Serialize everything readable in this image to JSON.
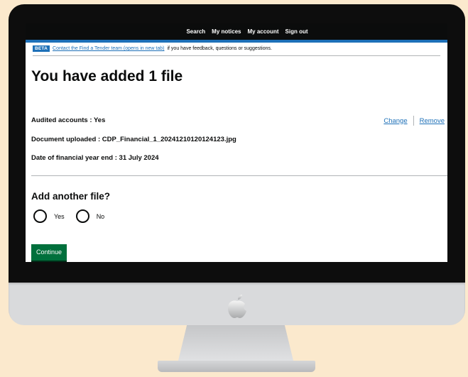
{
  "nav": {
    "links": [
      "Search",
      "My notices",
      "My account",
      "Sign out"
    ]
  },
  "banner": {
    "tag": "BETA",
    "link_text": "Contact the Find a Tender team (opens in new tab)",
    "rest_text": "if you have feedback, questions or suggestions."
  },
  "page": {
    "title": "You have added 1 file"
  },
  "summary": {
    "audited": "Audited accounts : Yes",
    "document": "Document uploaded : CDP_Financial_1_20241210120124123.jpg",
    "date": "Date of financial year end : 31 July 2024",
    "change_label": "Change",
    "remove_label": "Remove"
  },
  "question": {
    "legend": "Add another file?",
    "options": [
      "Yes",
      "No"
    ]
  },
  "continue_label": "Continue",
  "colors": {
    "background": "#fbe9cd",
    "govuk_blue": "#1d70b8",
    "govuk_green": "#00703c",
    "black": "#0b0c0c"
  },
  "icons": [
    "apple-logo-icon"
  ]
}
